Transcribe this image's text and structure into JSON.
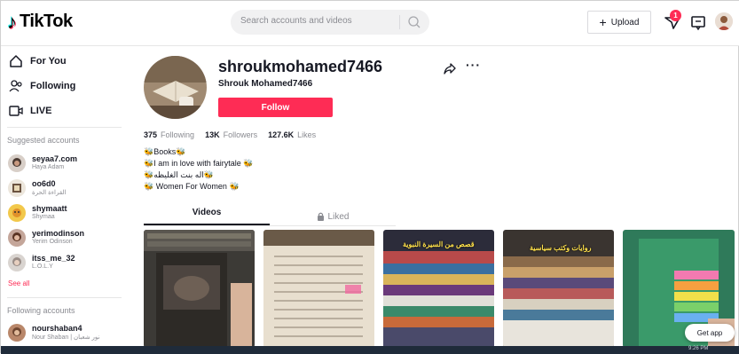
{
  "header": {
    "logo_text": "TikTok",
    "search_placeholder": "Search accounts and videos",
    "upload_label": "Upload",
    "inbox_badge": "1"
  },
  "sidebar": {
    "nav": [
      {
        "label": "For You",
        "icon": "home-icon"
      },
      {
        "label": "Following",
        "icon": "following-icon"
      },
      {
        "label": "LIVE",
        "icon": "live-icon"
      }
    ],
    "suggested_title": "Suggested accounts",
    "suggested": [
      {
        "name": "seyaa7.com",
        "sub": "Haya Adam"
      },
      {
        "name": "oo6d0",
        "sub": "القراءة الحرة"
      },
      {
        "name": "shymaatt",
        "sub": "Shymaa"
      },
      {
        "name": "yerimodinson",
        "sub": "Yerim Odinson"
      },
      {
        "name": "itss_me_32",
        "sub": "L.O.L.Y"
      }
    ],
    "see_all": "See all",
    "following_title": "Following accounts",
    "following": [
      {
        "name": "nourshaban4",
        "sub": "Nour Shaban | نور شعبان"
      }
    ]
  },
  "profile": {
    "username": "shroukmohamed7466",
    "display_name": "Shrouk Mohamed7466",
    "follow_label": "Follow",
    "following_count": "375",
    "following_label": "Following",
    "followers_count": "13K",
    "followers_label": "Followers",
    "likes_count": "127.6K",
    "likes_label": "Likes",
    "bio": [
      "Books",
      "I am in love with fairytale",
      "اله بنت الغليظه",
      "Women For Women"
    ]
  },
  "tabs": {
    "videos": "Videos",
    "liked": "Liked"
  },
  "videos": [
    {
      "caption": ""
    },
    {
      "caption": ""
    },
    {
      "caption": "قصص من السيرة النبوية"
    },
    {
      "caption": "روايات وكتب سياسية"
    },
    {
      "caption": ""
    }
  ],
  "get_app": "Get app",
  "clock": "9:26 PM",
  "colors": {
    "accent": "#fe2c55",
    "text": "#161823",
    "muted": "#8a8b91"
  }
}
